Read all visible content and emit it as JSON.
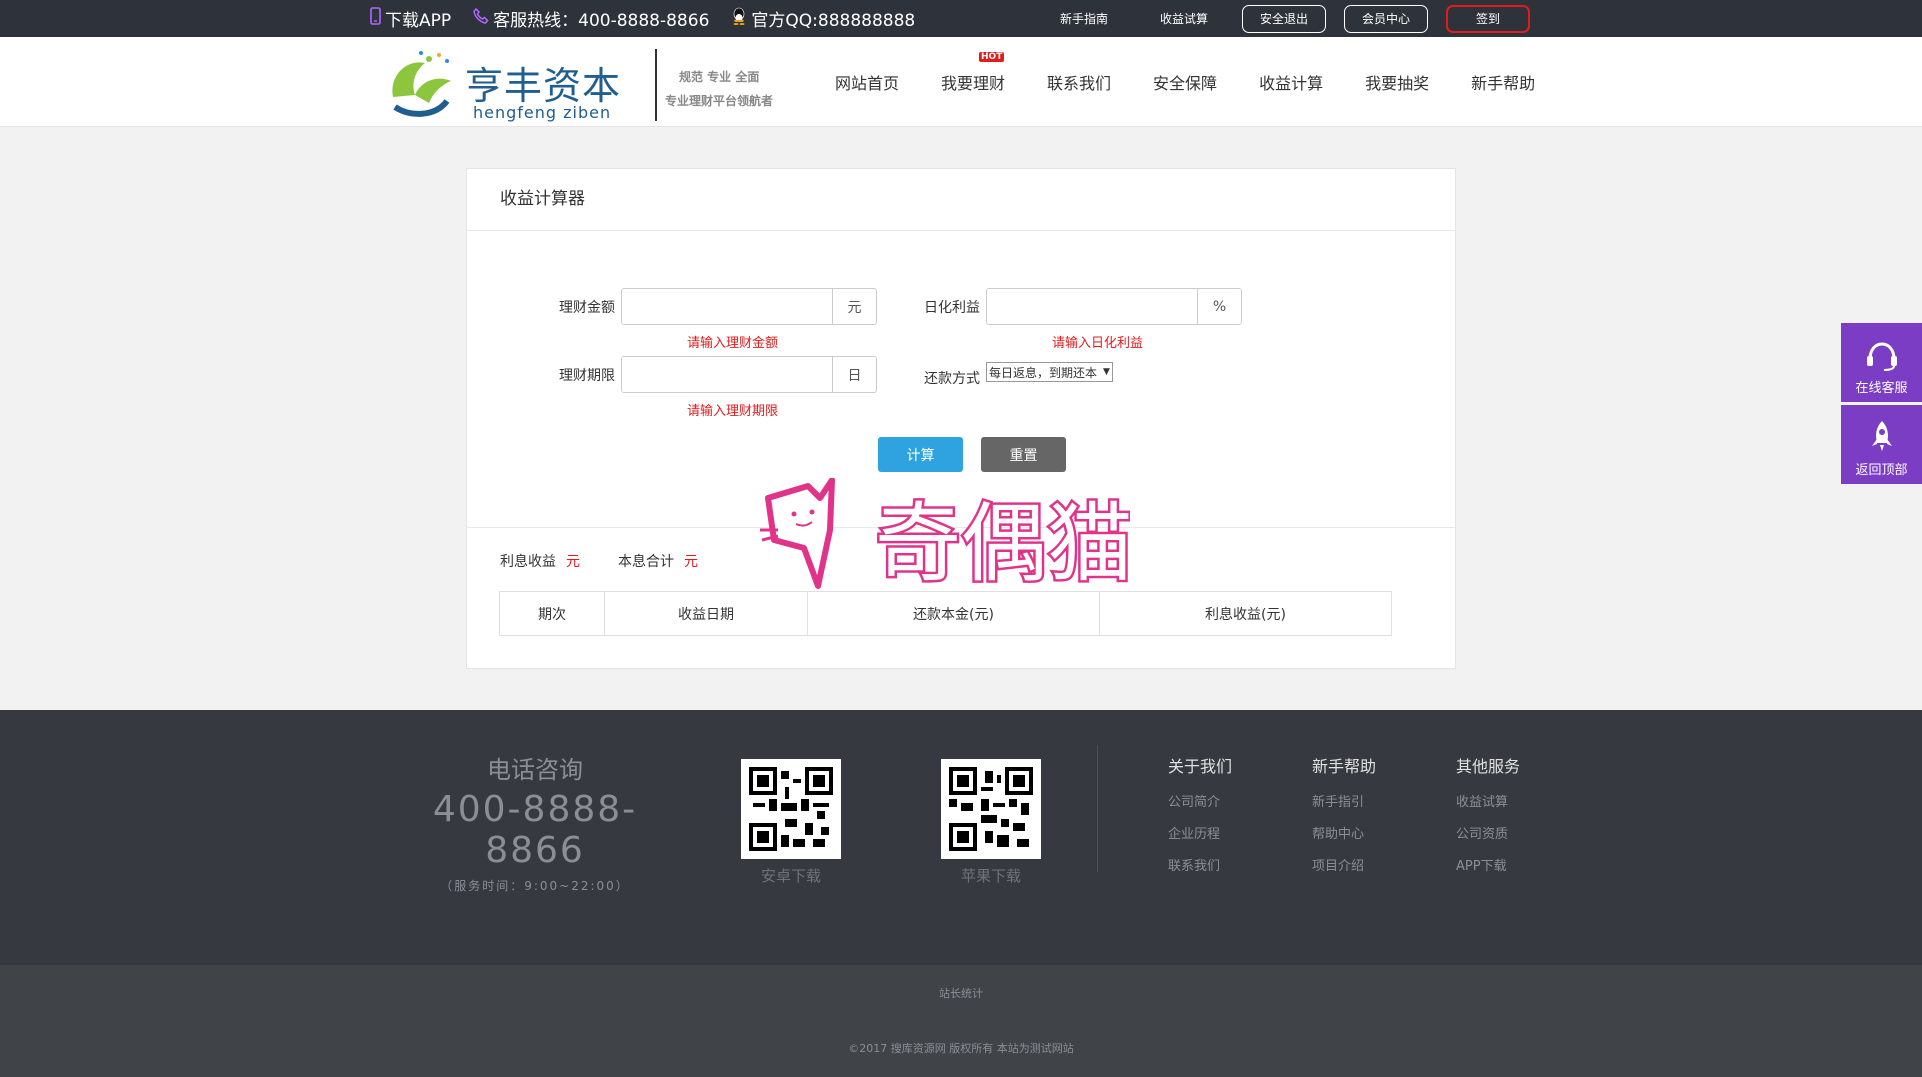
{
  "topbar": {
    "app": "下载APP",
    "hotline": "客服热线：400-8888-8866",
    "qq": "官方QQ:888888888",
    "links": [
      "新手指南",
      "收益试算"
    ],
    "logout": "安全退出",
    "member": "会员中心",
    "signin": "签到"
  },
  "header": {
    "logo_cn": "亨丰资本",
    "logo_en": "hengfeng  ziben",
    "slogan1": "规范  专业  全面",
    "slogan2": "专业理财平台领航者",
    "nav": [
      "网站首页",
      "我要理财",
      "联系我们",
      "安全保障",
      "收益计算",
      "我要抽奖",
      "新手帮助"
    ],
    "hot_badge": "HOT"
  },
  "calculator": {
    "title": "收益计算器",
    "amount_label": "理财金额",
    "amount_value": "",
    "amount_unit": "元",
    "amount_error": "请输入理财金额",
    "rate_label": "日化利益",
    "rate_value": "",
    "rate_unit": "%",
    "rate_error": "请输入日化利益",
    "period_label": "理财期限",
    "period_value": "",
    "period_unit": "日",
    "period_error": "请输入理财期限",
    "method_label": "还款方式",
    "method_selected": "每日返息，到期还本",
    "calc_button": "计算",
    "reset_button": "重置",
    "interest_label": "利息收益",
    "interest_unit": "元",
    "total_label": "本息合计",
    "total_unit": "元",
    "table_headers": [
      "期次",
      "收益日期",
      "还款本金(元)",
      "利息收益(元)"
    ]
  },
  "watermark": "奇偶猫",
  "float": {
    "service": "在线客服",
    "top": "返回顶部"
  },
  "footer": {
    "phone_title": "电话咨询",
    "phone": "400-8888-8866",
    "hours": "（服务时间：9:00~22:00）",
    "android": "安卓下载",
    "ios": "苹果下载",
    "cols": [
      {
        "title": "关于我们",
        "items": [
          "公司简介",
          "企业历程",
          "联系我们"
        ]
      },
      {
        "title": "新手帮助",
        "items": [
          "新手指引",
          "帮助中心",
          "项目介绍"
        ]
      },
      {
        "title": "其他服务",
        "items": [
          "收益试算",
          "公司资质",
          "APP下载"
        ]
      }
    ],
    "stats": "站长统计",
    "copyright": "©2017 搜库资源网 版权所有  本站为测试网站"
  },
  "colors": {
    "accent": "#2fa3e0",
    "error": "#e01c1c",
    "float_bg": "#7b3dc4",
    "watermark": "#e0338a"
  }
}
